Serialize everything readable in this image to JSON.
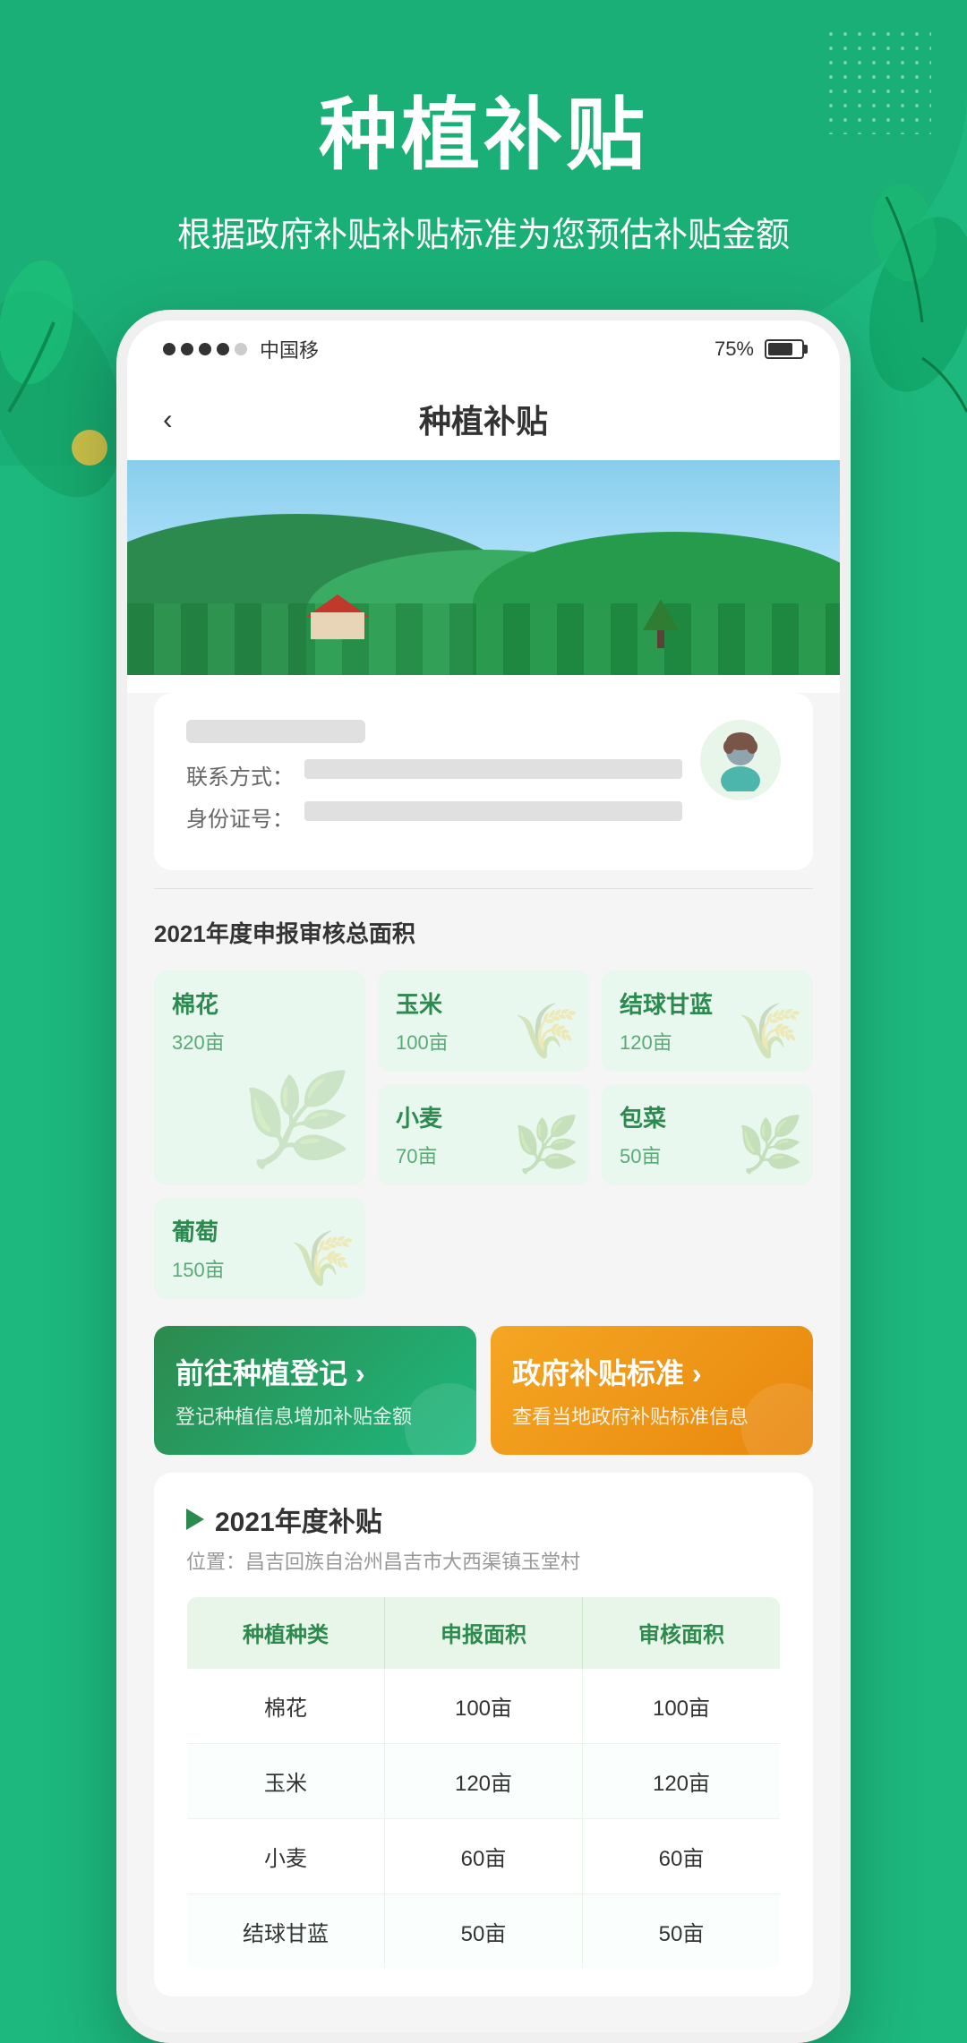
{
  "app": {
    "statusBar": {
      "carrier": "中国移",
      "battery": "75%"
    },
    "header": {
      "title": "种植补贴",
      "backLabel": "‹"
    }
  },
  "page": {
    "mainTitle": "种植补贴",
    "mainSubtitle": "根据政府补贴补贴标准为您预估补贴金额"
  },
  "userCard": {
    "contactLabel": "联系方式：",
    "idLabel": "身份证号："
  },
  "cropSection": {
    "yearTitle": "2021年度申报审核总面积",
    "crops": [
      {
        "name": "棉花",
        "area": "320亩",
        "large": true
      },
      {
        "name": "玉米",
        "area": "100亩",
        "large": false
      },
      {
        "name": "结球甘蓝",
        "area": "120亩",
        "large": false
      },
      {
        "name": "小麦",
        "area": "70亩",
        "large": false
      },
      {
        "name": "包菜",
        "area": "50亩",
        "large": false
      },
      {
        "name": "葡萄",
        "area": "150亩",
        "large": false
      }
    ]
  },
  "actionButtons": [
    {
      "id": "register",
      "title": "前往种植登记",
      "subtitle": "登记种植信息增加补贴金额",
      "arrow": "›",
      "style": "green"
    },
    {
      "id": "standard",
      "title": "政府补贴标准",
      "subtitle": "查看当地政府补贴标准信息",
      "arrow": "›",
      "style": "orange"
    }
  ],
  "subsidySection": {
    "title": "2021年度补贴",
    "location": "位置：昌吉回族自治州昌吉市大西渠镇玉堂村",
    "tableHeaders": [
      "种植种类",
      "申报面积",
      "审核面积"
    ],
    "tableRows": [
      {
        "type": "棉花",
        "reported": "100亩",
        "reviewed": "100亩"
      },
      {
        "type": "玉米",
        "reported": "120亩",
        "reviewed": "120亩"
      },
      {
        "type": "小麦",
        "reported": "60亩",
        "reviewed": "60亩"
      },
      {
        "type": "结球甘蓝",
        "reported": "50亩",
        "reviewed": "50亩"
      }
    ]
  }
}
